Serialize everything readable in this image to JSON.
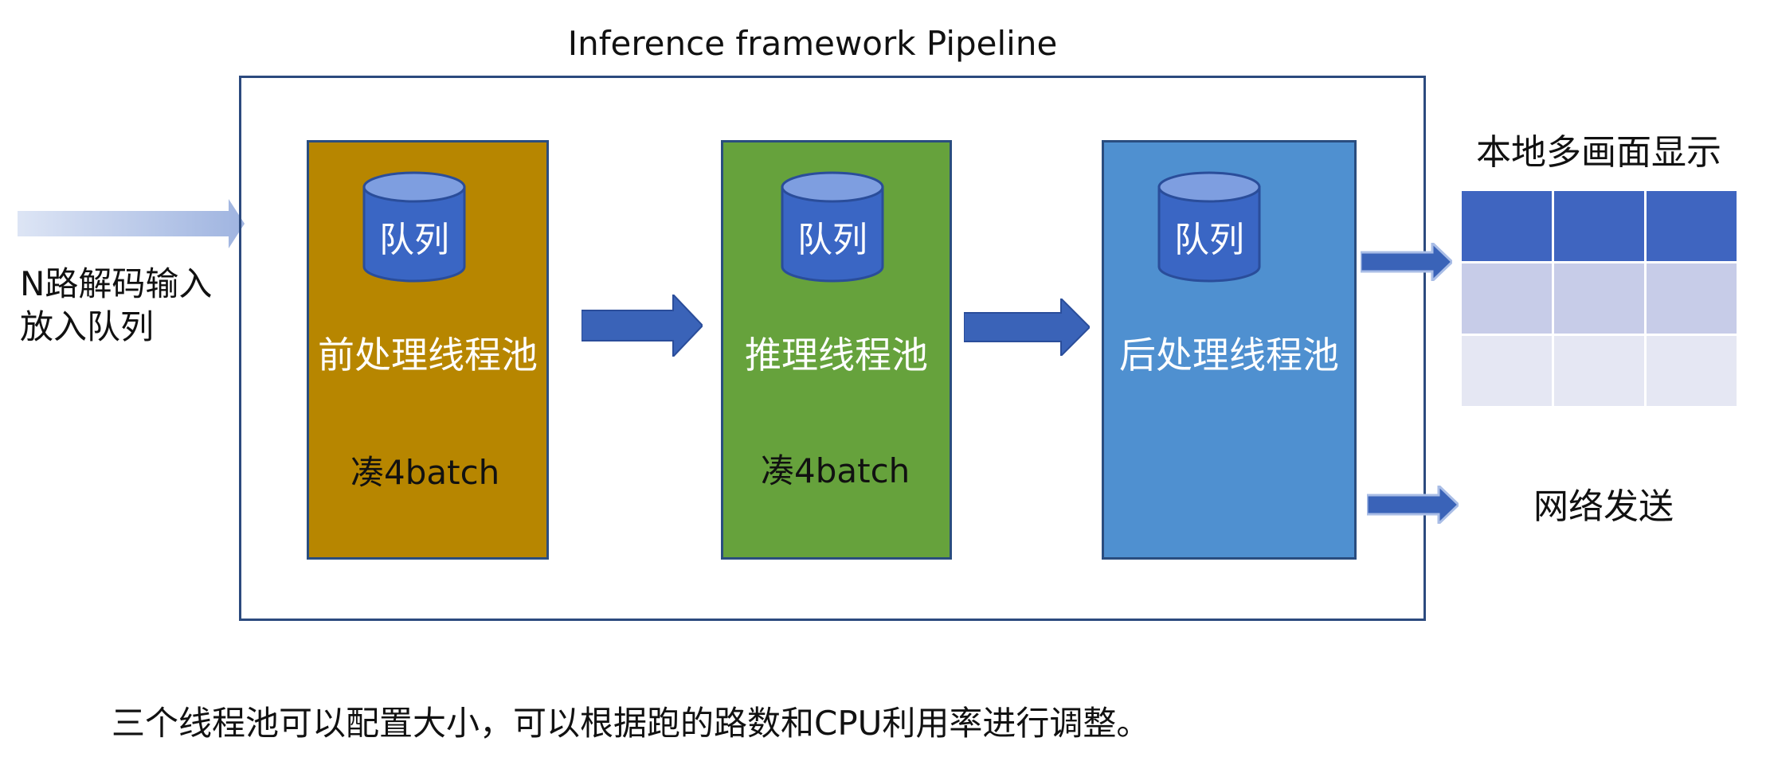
{
  "title": "Inference framework Pipeline",
  "input_label": [
    "N路解码输入",
    "放入队列"
  ],
  "pools": [
    {
      "name": "前处理线程池",
      "queue": "队列",
      "batch": "凑4batch",
      "color": "#b78600"
    },
    {
      "name": "推理线程池",
      "queue": "队列",
      "batch": "凑4batch",
      "color": "#66a23c"
    },
    {
      "name": "后处理线程池",
      "queue": "队列",
      "batch": "",
      "color": "#4f90d0"
    }
  ],
  "outputs": {
    "display": "本地多画面显示",
    "network": "网络发送"
  },
  "footer": "三个线程池可以配置大小，可以根据跑的路数和CPU利用率进行调整。",
  "colors": {
    "frame_border": "#2c4a7e",
    "arrow_blue": "#3a63b8",
    "grid_row1": "#3f65c0",
    "grid_row2": "#c7cce8",
    "grid_row3": "#e5e7f3"
  }
}
